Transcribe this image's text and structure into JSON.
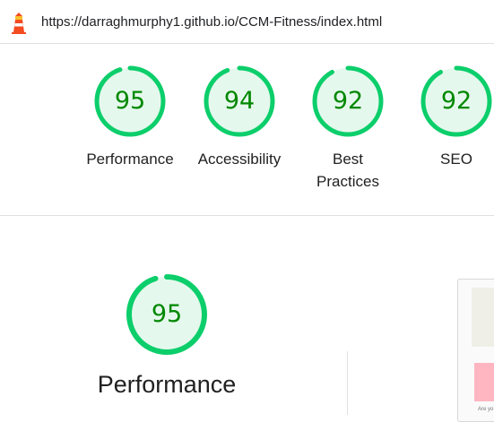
{
  "header": {
    "url": "https://darraghmurphy1.github.io/CCM-Fitness/index.html",
    "logo_icon": "lighthouse-icon"
  },
  "scores": [
    {
      "label": "Performance",
      "score": "95",
      "value": 95
    },
    {
      "label": "Accessibility",
      "score": "94",
      "value": 94
    },
    {
      "label": "Best Practices",
      "score": "92",
      "value": 92
    },
    {
      "label": "SEO",
      "score": "92",
      "value": 92
    }
  ],
  "detail": {
    "label": "Performance",
    "score": "95",
    "value": 95
  },
  "thumbnail": {
    "caption": "Are yo"
  },
  "colors": {
    "pass": "#0cce6b",
    "pass_fill": "#e5f8ed",
    "pass_text": "#008800",
    "divider": "#e0e0e0"
  }
}
